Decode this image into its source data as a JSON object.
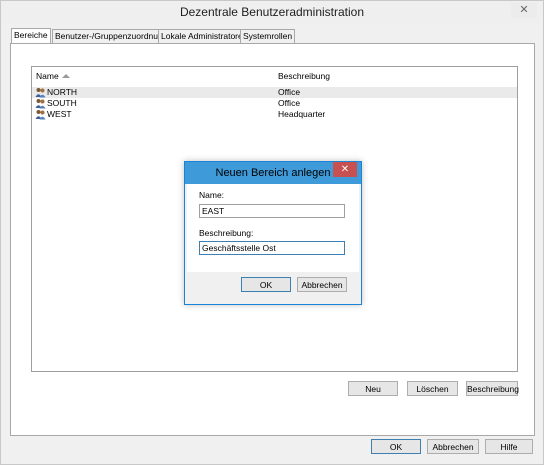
{
  "window": {
    "title": "Dezentrale Benutzeradministration",
    "close_glyph": "✕"
  },
  "tabs": [
    {
      "label": "Bereiche",
      "active": true
    },
    {
      "label": "Benutzer-/Gruppenzuordnung",
      "active": false
    },
    {
      "label": "Lokale Administratoren",
      "active": false
    },
    {
      "label": "Systemrollen",
      "active": false
    }
  ],
  "list": {
    "columns": {
      "name": "Name",
      "description": "Beschreibung"
    },
    "rows": [
      {
        "name": "NORTH",
        "description": "Office",
        "icon": "user-group-icon",
        "selected": true
      },
      {
        "name": "SOUTH",
        "description": "Office",
        "icon": "user-group-icon",
        "selected": false
      },
      {
        "name": "WEST",
        "description": "Headquarter",
        "icon": "user-group-icon",
        "selected": false
      }
    ]
  },
  "panel_buttons": {
    "new": "Neu",
    "delete": "Löschen",
    "description": "Beschreibung"
  },
  "dialog_buttons": {
    "ok": "OK",
    "cancel": "Abbrechen",
    "help": "Hilfe"
  },
  "new_area_dialog": {
    "title": "Neuen Bereich anlegen",
    "close_glyph": "✕",
    "name_label": "Name:",
    "name_value": "EAST",
    "description_label": "Beschreibung:",
    "description_value": "Geschäftsstelle Ost",
    "ok": "OK",
    "cancel": "Abbrechen"
  },
  "colors": {
    "dialog_accent": "#3f9ad9",
    "close_red": "#c75050"
  }
}
